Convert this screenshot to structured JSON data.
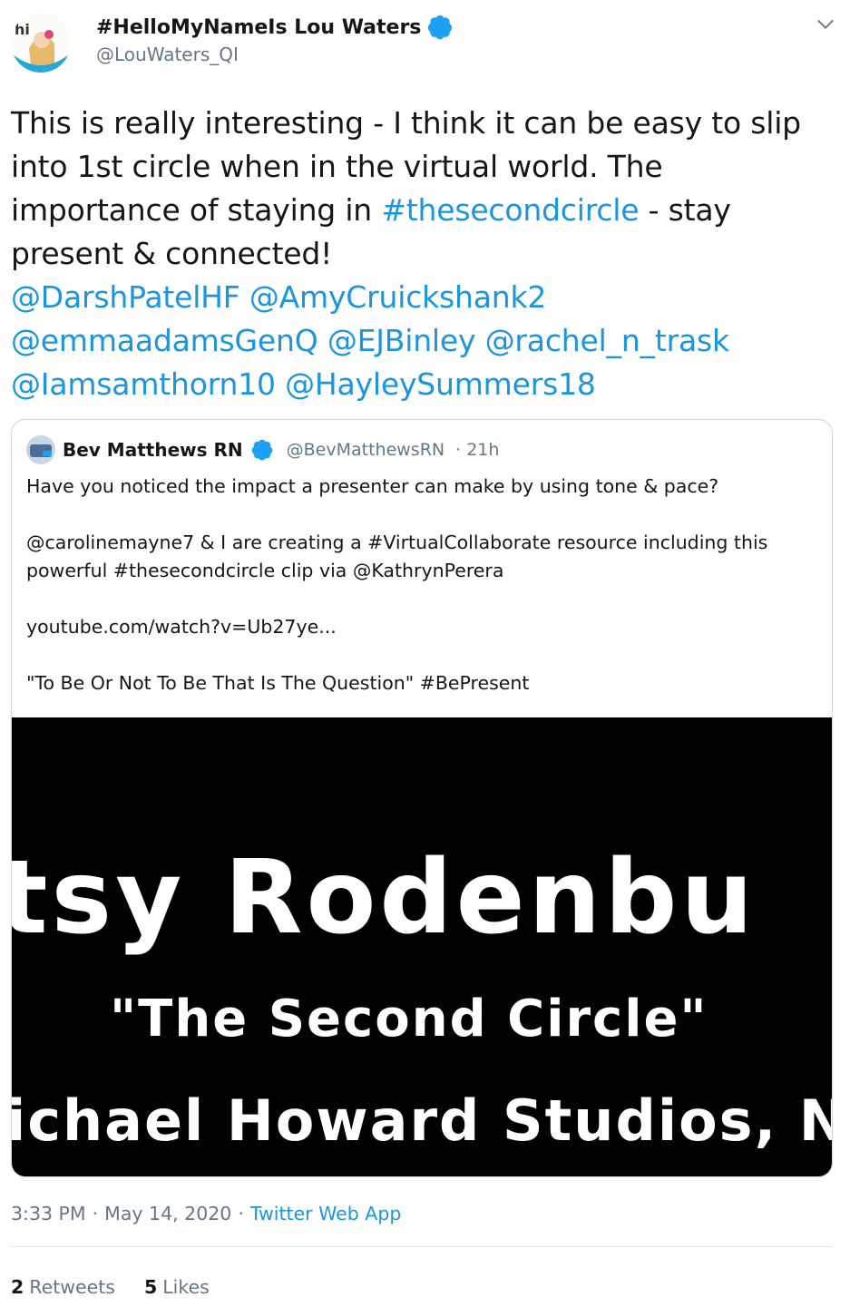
{
  "author": {
    "name": "#HelloMyNameIs Lou Waters",
    "handle": "@LouWaters_QI",
    "avatar_badge": "hi",
    "verified_color": "#1da1f2"
  },
  "tweet": {
    "text_lines": [
      "This is really interesting - I think it can be easy to slip into 1st circle when in the virtual world. The importance of staying in ",
      "#thesecondcircle",
      " - stay present & connected!"
    ],
    "mentions": [
      "@DarshPatelHF",
      "@AmyCruickshank2",
      "@emmaadamsGenQ",
      "@EJBinley",
      "@rachel_n_trask",
      "@Iamsamthorn10",
      "@HayleySummers18"
    ]
  },
  "quote": {
    "name": "Bev Matthews RN",
    "handle": "@BevMatthewsRN",
    "time": "· 21h",
    "line1": "Have you noticed the impact a presenter can make by using tone & pace?",
    "line2": "@carolinemayne7 & I are creating a #VirtualCollaborate resource including this powerful #thesecondcircle clip via @KathrynPerera",
    "line3": "youtube.com/watch?v=Ub27ye...",
    "line4": "\"To Be Or Not To Be That Is The Question\" #BePresent",
    "video": {
      "line1": "tsy Rodenbu",
      "line2": "\"The Second Circle\"",
      "line3": "ichael Howard Studios, N"
    }
  },
  "meta": {
    "time": "3:33 PM",
    "sep1": "·",
    "date": "May 14, 2020",
    "sep2": "·",
    "source": "Twitter Web App"
  },
  "stats": {
    "retweets_count": "2",
    "retweets_label": "Retweets",
    "likes_count": "5",
    "likes_label": "Likes"
  },
  "colors": {
    "link": "#1b95e0",
    "secondary_text": "#657786",
    "border": "#ccd6dd"
  }
}
